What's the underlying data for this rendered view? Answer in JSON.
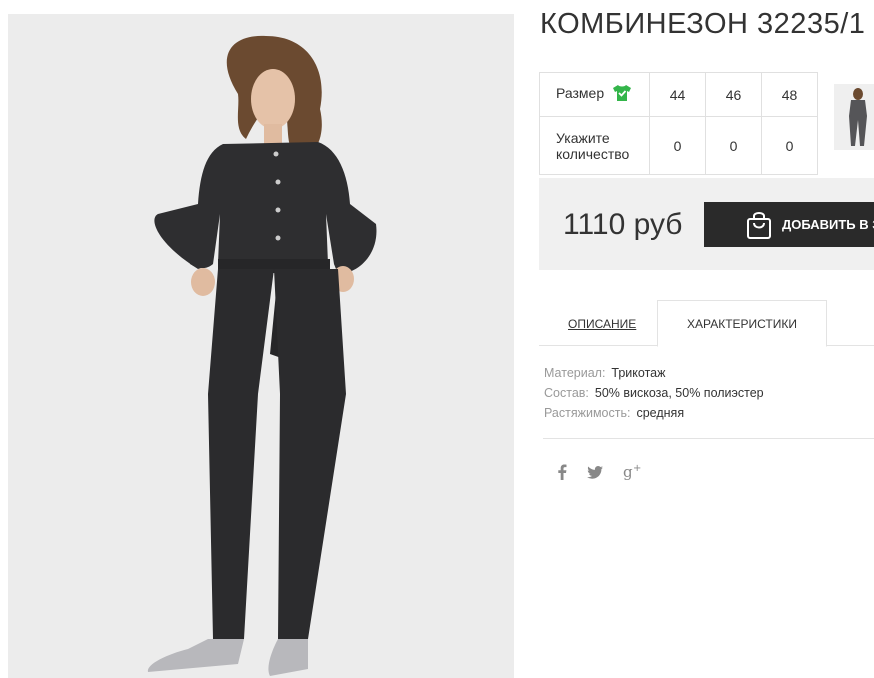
{
  "product": {
    "title": "КОМБИНЕЗОН 32235/1",
    "image_alt": "Женский трикотажный комбинезон с поясом"
  },
  "size_table": {
    "size_label": "Размер",
    "quantity_label": "Укажите количество",
    "sizes": [
      "44",
      "46",
      "48"
    ],
    "quantities": [
      "0",
      "0",
      "0"
    ]
  },
  "purchase": {
    "price": "1110 руб",
    "cart_label": "ДОБАВИТЬ В З"
  },
  "tabs": {
    "description": "ОПИСАНИЕ",
    "characteristics": "ХАРАКТЕРИСТИКИ"
  },
  "characteristics": [
    {
      "key": "Материал:",
      "value": "Трикотаж"
    },
    {
      "key": "Состав:",
      "value": "50% вискоза, 50% полиэстер"
    },
    {
      "key": "Растяжимость:",
      "value": "средняя"
    }
  ],
  "social": [
    "facebook-icon",
    "twitter-icon",
    "google-plus-icon"
  ],
  "colors": {
    "accent_green": "#33b54a",
    "button_dark": "#2a2a2a",
    "price_bg": "#f0f0f0"
  }
}
